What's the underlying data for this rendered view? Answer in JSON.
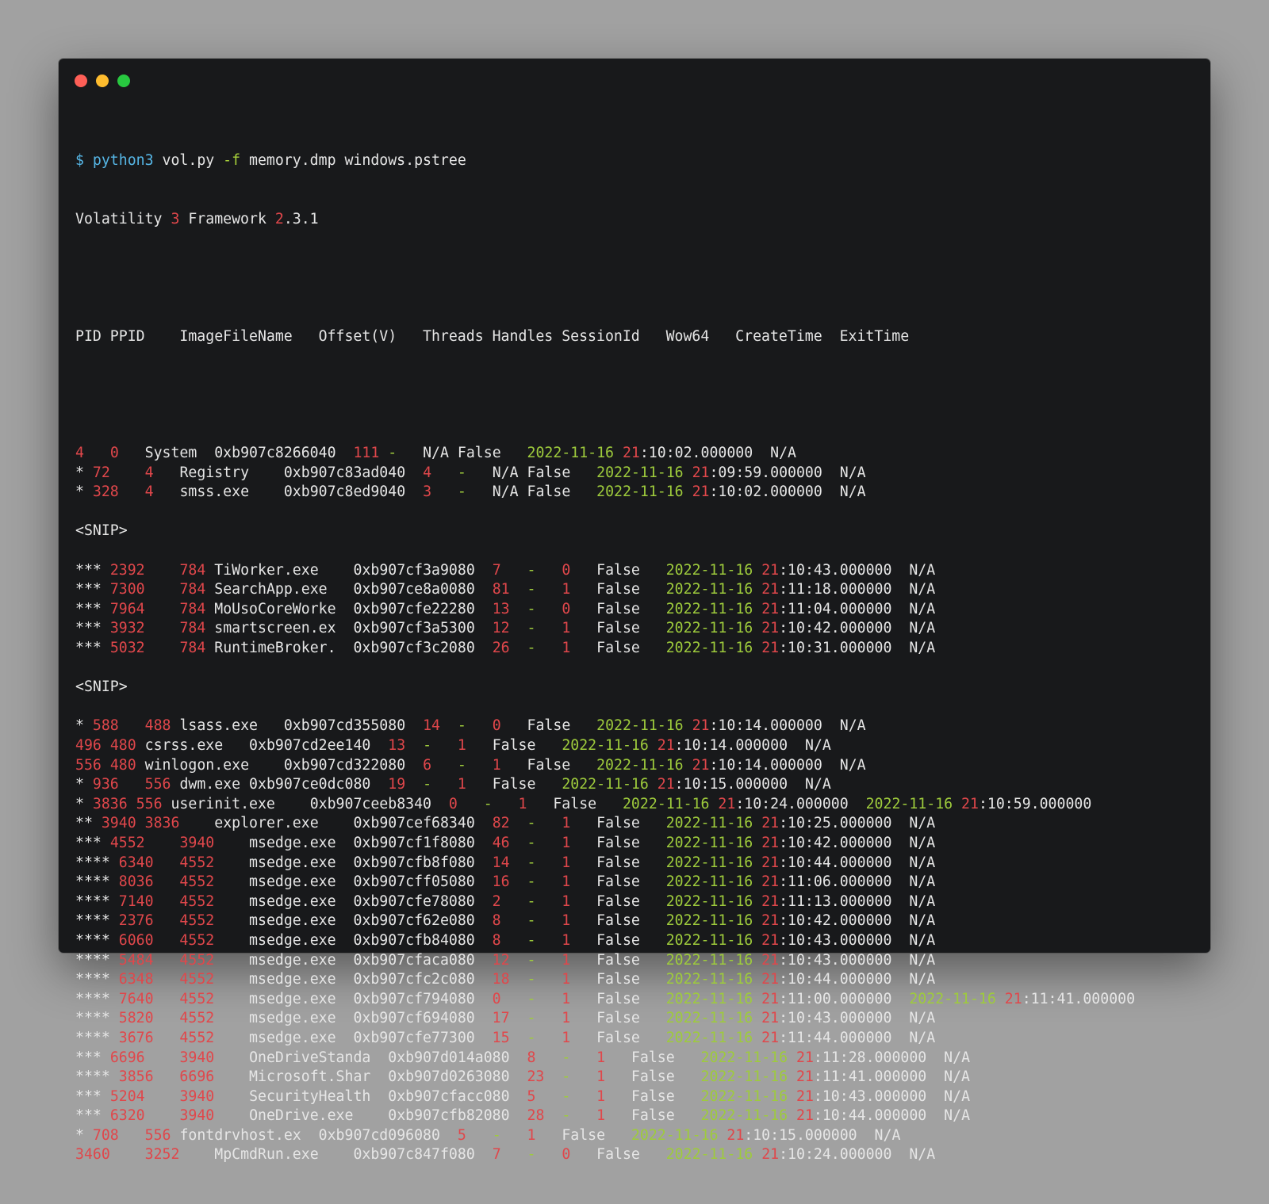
{
  "window": {
    "buttons": [
      "close",
      "minimize",
      "maximize"
    ]
  },
  "command": {
    "prompt": "$",
    "program": "python3",
    "script": "vol.py",
    "flag": "-f",
    "args": "memory.dmp windows.pstree"
  },
  "banner": {
    "name": "Volatility",
    "major": "3",
    "word": "Framework",
    "ver_major": "2",
    "ver_rest": ".3.1"
  },
  "header": "PID PPID    ImageFileName   Offset(V)   Threads Handles SessionId   Wow64   CreateTime  ExitTime",
  "rows": [
    {
      "pre": "",
      "pid": "4",
      "g1": "   ",
      "ppid": "0",
      "g2": "   ",
      "name": "System",
      "g3": "  ",
      "offset": "0xb907c8266040",
      "g4": "  ",
      "threads": "111",
      "g5": " ",
      "handles": "-",
      "g6": "   ",
      "session": "N/A",
      "g7": " ",
      "wow64": "False",
      "g8": "   ",
      "create": "2022-11-16 21:10:02.000000",
      "g9": "  ",
      "exit": "N/A"
    },
    {
      "pre": "* ",
      "pid": "72",
      "g1": "    ",
      "ppid": "4",
      "g2": "   ",
      "name": "Registry",
      "g3": "    ",
      "offset": "0xb907c83ad040",
      "g4": "  ",
      "threads": "4",
      "g5": "   ",
      "handles": "-",
      "g6": "   ",
      "session": "N/A",
      "g7": " ",
      "wow64": "False",
      "g8": "   ",
      "create": "2022-11-16 21:09:59.000000",
      "g9": "  ",
      "exit": "N/A"
    },
    {
      "pre": "* ",
      "pid": "328",
      "g1": "   ",
      "ppid": "4",
      "g2": "   ",
      "name": "smss.exe",
      "g3": "    ",
      "offset": "0xb907c8ed9040",
      "g4": "  ",
      "threads": "3",
      "g5": "   ",
      "handles": "-",
      "g6": "   ",
      "session": "N/A",
      "g7": " ",
      "wow64": "False",
      "g8": "   ",
      "create": "2022-11-16 21:10:02.000000",
      "g9": "  ",
      "exit": "N/A"
    },
    {
      "snip": "<SNIP>"
    },
    {
      "pre": "*** ",
      "pid": "2392",
      "g1": "    ",
      "ppid": "784",
      "g2": " ",
      "name": "TiWorker.exe",
      "g3": "    ",
      "offset": "0xb907cf3a9080",
      "g4": "  ",
      "threads": "7",
      "g5": "   ",
      "handles": "-",
      "g6": "   ",
      "session": "0",
      "g7": "   ",
      "wow64": "False",
      "g8": "   ",
      "create": "2022-11-16 21:10:43.000000",
      "g9": "  ",
      "exit": "N/A"
    },
    {
      "pre": "*** ",
      "pid": "7300",
      "g1": "    ",
      "ppid": "784",
      "g2": " ",
      "name": "SearchApp.exe",
      "g3": "   ",
      "offset": "0xb907ce8a0080",
      "g4": "  ",
      "threads": "81",
      "g5": "  ",
      "handles": "-",
      "g6": "   ",
      "session": "1",
      "g7": "   ",
      "wow64": "False",
      "g8": "   ",
      "create": "2022-11-16 21:11:18.000000",
      "g9": "  ",
      "exit": "N/A"
    },
    {
      "pre": "*** ",
      "pid": "7964",
      "g1": "    ",
      "ppid": "784",
      "g2": " ",
      "name": "MoUsoCoreWorke",
      "g3": "  ",
      "offset": "0xb907cfe22280",
      "g4": "  ",
      "threads": "13",
      "g5": "  ",
      "handles": "-",
      "g6": "   ",
      "session": "0",
      "g7": "   ",
      "wow64": "False",
      "g8": "   ",
      "create": "2022-11-16 21:11:04.000000",
      "g9": "  ",
      "exit": "N/A"
    },
    {
      "pre": "*** ",
      "pid": "3932",
      "g1": "    ",
      "ppid": "784",
      "g2": " ",
      "name": "smartscreen.ex",
      "g3": "  ",
      "offset": "0xb907cf3a5300",
      "g4": "  ",
      "threads": "12",
      "g5": "  ",
      "handles": "-",
      "g6": "   ",
      "session": "1",
      "g7": "   ",
      "wow64": "False",
      "g8": "   ",
      "create": "2022-11-16 21:10:42.000000",
      "g9": "  ",
      "exit": "N/A"
    },
    {
      "pre": "*** ",
      "pid": "5032",
      "g1": "    ",
      "ppid": "784",
      "g2": " ",
      "name": "RuntimeBroker.",
      "g3": "  ",
      "offset": "0xb907cf3c2080",
      "g4": "  ",
      "threads": "26",
      "g5": "  ",
      "handles": "-",
      "g6": "   ",
      "session": "1",
      "g7": "   ",
      "wow64": "False",
      "g8": "   ",
      "create": "2022-11-16 21:10:31.000000",
      "g9": "  ",
      "exit": "N/A"
    },
    {
      "snip": "<SNIP>"
    },
    {
      "pre": "* ",
      "pid": "588",
      "g1": "   ",
      "ppid": "488",
      "g2": " ",
      "name": "lsass.exe",
      "g3": "   ",
      "offset": "0xb907cd355080",
      "g4": "  ",
      "threads": "14",
      "g5": "  ",
      "handles": "-",
      "g6": "   ",
      "session": "0",
      "g7": "   ",
      "wow64": "False",
      "g8": "   ",
      "create": "2022-11-16 21:10:14.000000",
      "g9": "  ",
      "exit": "N/A"
    },
    {
      "pre": "",
      "pid": "496",
      "g1": " ",
      "ppid": "480",
      "g2": " ",
      "name": "csrss.exe",
      "g3": "   ",
      "offset": "0xb907cd2ee140",
      "g4": "  ",
      "threads": "13",
      "g5": "  ",
      "handles": "-",
      "g6": "   ",
      "session": "1",
      "g7": "   ",
      "wow64": "False",
      "g8": "   ",
      "create": "2022-11-16 21:10:14.000000",
      "g9": "  ",
      "exit": "N/A"
    },
    {
      "pre": "",
      "pid": "556",
      "g1": " ",
      "ppid": "480",
      "g2": " ",
      "name": "winlogon.exe",
      "g3": "    ",
      "offset": "0xb907cd322080",
      "g4": "  ",
      "threads": "6",
      "g5": "   ",
      "handles": "-",
      "g6": "   ",
      "session": "1",
      "g7": "   ",
      "wow64": "False",
      "g8": "   ",
      "create": "2022-11-16 21:10:14.000000",
      "g9": "  ",
      "exit": "N/A"
    },
    {
      "pre": "* ",
      "pid": "936",
      "g1": "   ",
      "ppid": "556",
      "g2": " ",
      "name": "dwm.exe",
      "g3": " ",
      "offset": "0xb907ce0dc080",
      "g4": "  ",
      "threads": "19",
      "g5": "  ",
      "handles": "-",
      "g6": "   ",
      "session": "1",
      "g7": "   ",
      "wow64": "False",
      "g8": "   ",
      "create": "2022-11-16 21:10:15.000000",
      "g9": "  ",
      "exit": "N/A"
    },
    {
      "pre": "* ",
      "pid": "3836",
      "g1": " ",
      "ppid": "556",
      "g2": " ",
      "name": "userinit.exe",
      "g3": "    ",
      "offset": "0xb907ceeb8340",
      "g4": "  ",
      "threads": "0",
      "g5": "   ",
      "handles": "-",
      "g6": "   ",
      "session": "1",
      "g7": "   ",
      "wow64": "False",
      "g8": "   ",
      "create": "2022-11-16 21:10:24.000000",
      "g9": "  ",
      "exit": "2022-11-16 21:10:59.000000"
    },
    {
      "pre": "** ",
      "pid": "3940",
      "g1": " ",
      "ppid": "3836",
      "g2": "    ",
      "name": "explorer.exe",
      "g3": "    ",
      "offset": "0xb907cef68340",
      "g4": "  ",
      "threads": "82",
      "g5": "  ",
      "handles": "-",
      "g6": "   ",
      "session": "1",
      "g7": "   ",
      "wow64": "False",
      "g8": "   ",
      "create": "2022-11-16 21:10:25.000000",
      "g9": "  ",
      "exit": "N/A"
    },
    {
      "pre": "*** ",
      "pid": "4552",
      "g1": "    ",
      "ppid": "3940",
      "g2": "    ",
      "name": "msedge.exe",
      "g3": "  ",
      "offset": "0xb907cf1f8080",
      "g4": "  ",
      "threads": "46",
      "g5": "  ",
      "handles": "-",
      "g6": "   ",
      "session": "1",
      "g7": "   ",
      "wow64": "False",
      "g8": "   ",
      "create": "2022-11-16 21:10:42.000000",
      "g9": "  ",
      "exit": "N/A"
    },
    {
      "pre": "**** ",
      "pid": "6340",
      "g1": "   ",
      "ppid": "4552",
      "g2": "    ",
      "name": "msedge.exe",
      "g3": "  ",
      "offset": "0xb907cfb8f080",
      "g4": "  ",
      "threads": "14",
      "g5": "  ",
      "handles": "-",
      "g6": "   ",
      "session": "1",
      "g7": "   ",
      "wow64": "False",
      "g8": "   ",
      "create": "2022-11-16 21:10:44.000000",
      "g9": "  ",
      "exit": "N/A"
    },
    {
      "pre": "**** ",
      "pid": "8036",
      "g1": "   ",
      "ppid": "4552",
      "g2": "    ",
      "name": "msedge.exe",
      "g3": "  ",
      "offset": "0xb907cff05080",
      "g4": "  ",
      "threads": "16",
      "g5": "  ",
      "handles": "-",
      "g6": "   ",
      "session": "1",
      "g7": "   ",
      "wow64": "False",
      "g8": "   ",
      "create": "2022-11-16 21:11:06.000000",
      "g9": "  ",
      "exit": "N/A"
    },
    {
      "pre": "**** ",
      "pid": "7140",
      "g1": "   ",
      "ppid": "4552",
      "g2": "    ",
      "name": "msedge.exe",
      "g3": "  ",
      "offset": "0xb907cfe78080",
      "g4": "  ",
      "threads": "2",
      "g5": "   ",
      "handles": "-",
      "g6": "   ",
      "session": "1",
      "g7": "   ",
      "wow64": "False",
      "g8": "   ",
      "create": "2022-11-16 21:11:13.000000",
      "g9": "  ",
      "exit": "N/A"
    },
    {
      "pre": "**** ",
      "pid": "2376",
      "g1": "   ",
      "ppid": "4552",
      "g2": "    ",
      "name": "msedge.exe",
      "g3": "  ",
      "offset": "0xb907cf62e080",
      "g4": "  ",
      "threads": "8",
      "g5": "   ",
      "handles": "-",
      "g6": "   ",
      "session": "1",
      "g7": "   ",
      "wow64": "False",
      "g8": "   ",
      "create": "2022-11-16 21:10:42.000000",
      "g9": "  ",
      "exit": "N/A"
    },
    {
      "pre": "**** ",
      "pid": "6060",
      "g1": "   ",
      "ppid": "4552",
      "g2": "    ",
      "name": "msedge.exe",
      "g3": "  ",
      "offset": "0xb907cfb84080",
      "g4": "  ",
      "threads": "8",
      "g5": "   ",
      "handles": "-",
      "g6": "   ",
      "session": "1",
      "g7": "   ",
      "wow64": "False",
      "g8": "   ",
      "create": "2022-11-16 21:10:43.000000",
      "g9": "  ",
      "exit": "N/A"
    },
    {
      "pre": "**** ",
      "pid": "5484",
      "g1": "   ",
      "ppid": "4552",
      "g2": "    ",
      "name": "msedge.exe",
      "g3": "  ",
      "offset": "0xb907cfaca080",
      "g4": "  ",
      "threads": "12",
      "g5": "  ",
      "handles": "-",
      "g6": "   ",
      "session": "1",
      "g7": "   ",
      "wow64": "False",
      "g8": "   ",
      "create": "2022-11-16 21:10:43.000000",
      "g9": "  ",
      "exit": "N/A"
    },
    {
      "pre": "**** ",
      "pid": "6348",
      "g1": "   ",
      "ppid": "4552",
      "g2": "    ",
      "name": "msedge.exe",
      "g3": "  ",
      "offset": "0xb907cfc2c080",
      "g4": "  ",
      "threads": "18",
      "g5": "  ",
      "handles": "-",
      "g6": "   ",
      "session": "1",
      "g7": "   ",
      "wow64": "False",
      "g8": "   ",
      "create": "2022-11-16 21:10:44.000000",
      "g9": "  ",
      "exit": "N/A"
    },
    {
      "pre": "**** ",
      "pid": "7640",
      "g1": "   ",
      "ppid": "4552",
      "g2": "    ",
      "name": "msedge.exe",
      "g3": "  ",
      "offset": "0xb907cf794080",
      "g4": "  ",
      "threads": "0",
      "g5": "   ",
      "handles": "-",
      "g6": "   ",
      "session": "1",
      "g7": "   ",
      "wow64": "False",
      "g8": "   ",
      "create": "2022-11-16 21:11:00.000000",
      "g9": "  ",
      "exit": "2022-11-16 21:11:41.000000"
    },
    {
      "pre": "**** ",
      "pid": "5820",
      "g1": "   ",
      "ppid": "4552",
      "g2": "    ",
      "name": "msedge.exe",
      "g3": "  ",
      "offset": "0xb907cf694080",
      "g4": "  ",
      "threads": "17",
      "g5": "  ",
      "handles": "-",
      "g6": "   ",
      "session": "1",
      "g7": "   ",
      "wow64": "False",
      "g8": "   ",
      "create": "2022-11-16 21:10:43.000000",
      "g9": "  ",
      "exit": "N/A"
    },
    {
      "pre": "**** ",
      "pid": "3676",
      "g1": "   ",
      "ppid": "4552",
      "g2": "    ",
      "name": "msedge.exe",
      "g3": "  ",
      "offset": "0xb907cfe77300",
      "g4": "  ",
      "threads": "15",
      "g5": "  ",
      "handles": "-",
      "g6": "   ",
      "session": "1",
      "g7": "   ",
      "wow64": "False",
      "g8": "   ",
      "create": "2022-11-16 21:11:44.000000",
      "g9": "  ",
      "exit": "N/A"
    },
    {
      "pre": "*** ",
      "pid": "6696",
      "g1": "    ",
      "ppid": "3940",
      "g2": "    ",
      "name": "OneDriveStanda",
      "g3": "  ",
      "offset": "0xb907d014a080",
      "g4": "  ",
      "threads": "8",
      "g5": "   ",
      "handles": "-",
      "g6": "   ",
      "session": "1",
      "g7": "   ",
      "wow64": "False",
      "g8": "   ",
      "create": "2022-11-16 21:11:28.000000",
      "g9": "  ",
      "exit": "N/A"
    },
    {
      "pre": "**** ",
      "pid": "3856",
      "g1": "   ",
      "ppid": "6696",
      "g2": "    ",
      "name": "Microsoft.Shar",
      "g3": "  ",
      "offset": "0xb907d0263080",
      "g4": "  ",
      "threads": "23",
      "g5": "  ",
      "handles": "-",
      "g6": "   ",
      "session": "1",
      "g7": "   ",
      "wow64": "False",
      "g8": "   ",
      "create": "2022-11-16 21:11:41.000000",
      "g9": "  ",
      "exit": "N/A"
    },
    {
      "pre": "*** ",
      "pid": "5204",
      "g1": "    ",
      "ppid": "3940",
      "g2": "    ",
      "name": "SecurityHealth",
      "g3": "  ",
      "offset": "0xb907cfacc080",
      "g4": "  ",
      "threads": "5",
      "g5": "   ",
      "handles": "-",
      "g6": "   ",
      "session": "1",
      "g7": "   ",
      "wow64": "False",
      "g8": "   ",
      "create": "2022-11-16 21:10:43.000000",
      "g9": "  ",
      "exit": "N/A"
    },
    {
      "pre": "*** ",
      "pid": "6320",
      "g1": "    ",
      "ppid": "3940",
      "g2": "    ",
      "name": "OneDrive.exe",
      "g3": "    ",
      "offset": "0xb907cfb82080",
      "g4": "  ",
      "threads": "28",
      "g5": "  ",
      "handles": "-",
      "g6": "   ",
      "session": "1",
      "g7": "   ",
      "wow64": "False",
      "g8": "   ",
      "create": "2022-11-16 21:10:44.000000",
      "g9": "  ",
      "exit": "N/A"
    },
    {
      "pre": "* ",
      "pid": "708",
      "g1": "   ",
      "ppid": "556",
      "g2": " ",
      "name": "fontdrvhost.ex",
      "g3": "  ",
      "offset": "0xb907cd096080",
      "g4": "  ",
      "threads": "5",
      "g5": "   ",
      "handles": "-",
      "g6": "   ",
      "session": "1",
      "g7": "   ",
      "wow64": "False",
      "g8": "   ",
      "create": "2022-11-16 21:10:15.000000",
      "g9": "  ",
      "exit": "N/A"
    },
    {
      "pre": "",
      "pid": "3460",
      "g1": "    ",
      "ppid": "3252",
      "g2": "    ",
      "name": "MpCmdRun.exe",
      "g3": "    ",
      "offset": "0xb907c847f080",
      "g4": "  ",
      "threads": "7",
      "g5": "   ",
      "handles": "-",
      "g6": "   ",
      "session": "0",
      "g7": "   ",
      "wow64": "False",
      "g8": "   ",
      "create": "2022-11-16 21:10:24.000000",
      "g9": "  ",
      "exit": "N/A"
    }
  ],
  "colors": {
    "number": "#e0474b",
    "date": "#9ecb3c",
    "command": "#56b6e6",
    "text": "#e6e6e6",
    "window_bg": "#18191b",
    "page_bg": "#a1a1a1"
  }
}
